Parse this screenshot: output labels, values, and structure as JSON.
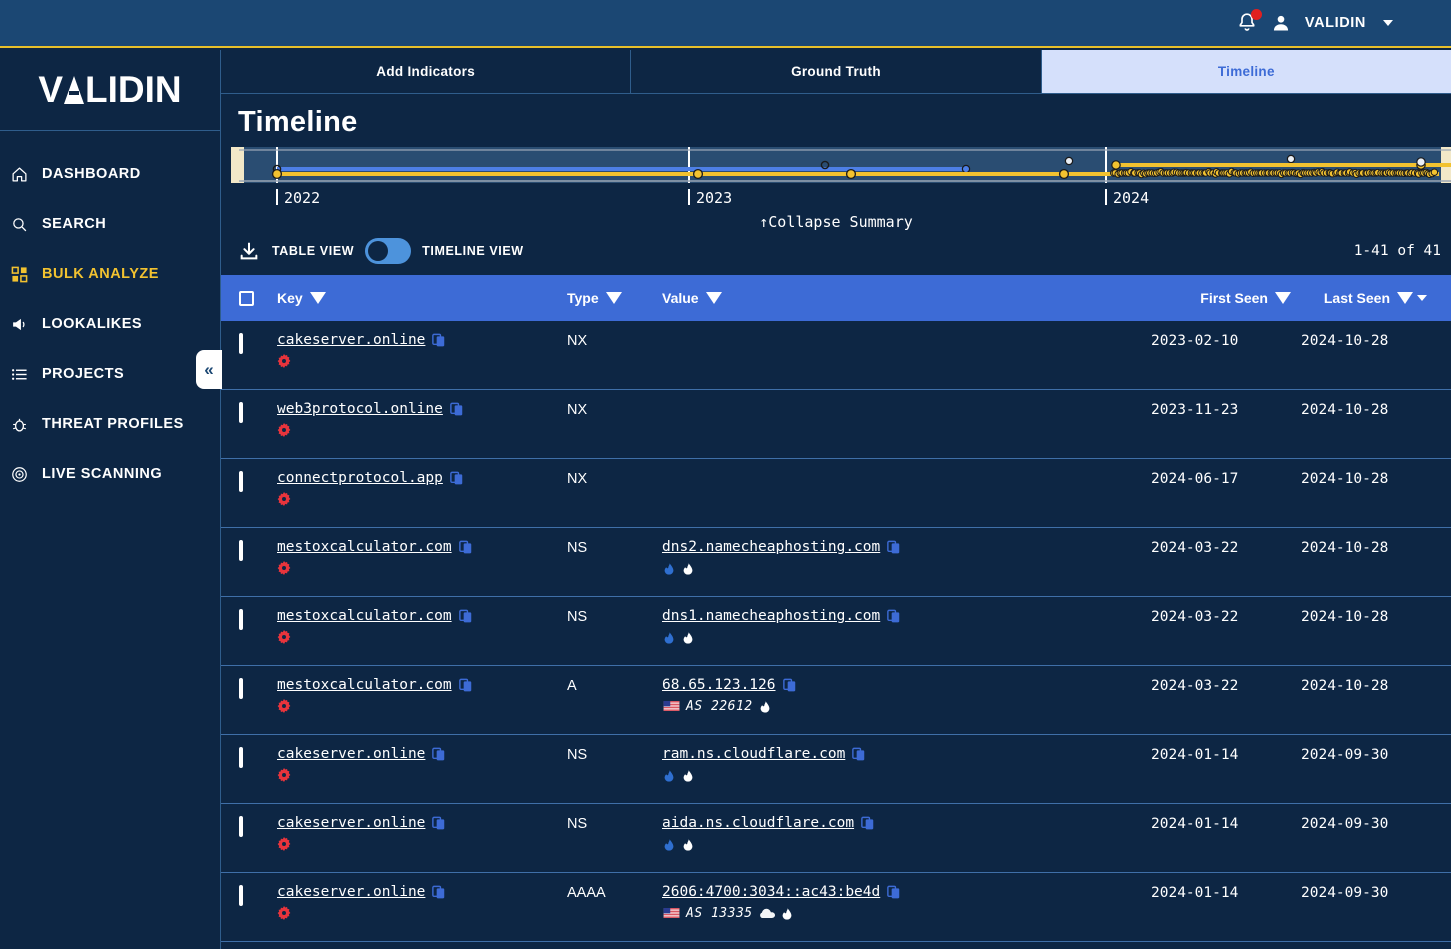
{
  "topbar": {
    "bell_icon": "bell-icon",
    "notification_badge": "",
    "user_icon": "user-avatar-icon",
    "user_name": "VALIDIN"
  },
  "sidebar": {
    "logo": "VALIDIN",
    "items": [
      {
        "label": "DASHBOARD",
        "icon": "home-icon",
        "active": false
      },
      {
        "label": "SEARCH",
        "icon": "search-icon",
        "active": false
      },
      {
        "label": "BULK ANALYZE",
        "icon": "grid-icon",
        "active": true
      },
      {
        "label": "LOOKALIKES",
        "icon": "megaphone-icon",
        "active": false
      },
      {
        "label": "PROJECTS",
        "icon": "list-icon",
        "active": false
      },
      {
        "label": "THREAT PROFILES",
        "icon": "bug-icon",
        "active": false
      },
      {
        "label": "LIVE SCANNING",
        "icon": "target-icon",
        "active": false
      }
    ],
    "collapse_label": "«"
  },
  "tabs": [
    {
      "label": "Add Indicators",
      "active": false
    },
    {
      "label": "Ground Truth",
      "active": false
    },
    {
      "label": "Timeline",
      "active": true
    }
  ],
  "main": {
    "title": "Timeline",
    "collapse_summary": "↑Collapse Summary",
    "download_icon": "download-icon",
    "table_view_label": "TABLE VIEW",
    "timeline_view_label": "TIMELINE VIEW",
    "toggle_state": "timeline",
    "count_label": "1-41 of 41"
  },
  "chart_data": {
    "type": "timeline",
    "title": "Timeline",
    "xlabels": [
      "2022",
      "2023",
      "2024"
    ],
    "xlabel_positions": [
      0.038,
      0.375,
      0.72
    ],
    "axis_range": [
      "2021-11",
      "2024-11"
    ],
    "grid": false,
    "series": [
      {
        "name": "blue-track",
        "color": "#4d7fe6",
        "start": 0.038,
        "end": 0.605
      },
      {
        "name": "yellow-track",
        "color": "#f2c230",
        "start": 0.038,
        "end": 0.99
      }
    ],
    "markers_color": "#f2c230",
    "selection_handle_color": "#f2e8c8"
  },
  "table": {
    "columns": [
      {
        "key": "checkbox",
        "label": "",
        "filter": false
      },
      {
        "key": "key",
        "label": "Key",
        "filter": true
      },
      {
        "key": "type",
        "label": "Type",
        "filter": true
      },
      {
        "key": "value",
        "label": "Value",
        "filter": true
      },
      {
        "key": "first_seen",
        "label": "First Seen",
        "filter": true
      },
      {
        "key": "last_seen",
        "label": "Last Seen",
        "filter": true,
        "sorted": "desc"
      }
    ],
    "rows": [
      {
        "key": "cakeserver.online",
        "key_gear": true,
        "type": "NX",
        "value": "",
        "value_icons": [],
        "first_seen": "2023-02-10",
        "last_seen": "2024-10-28"
      },
      {
        "key": "web3protocol.online",
        "key_gear": true,
        "type": "NX",
        "value": "",
        "value_icons": [],
        "first_seen": "2023-11-23",
        "last_seen": "2024-10-28"
      },
      {
        "key": "connectprotocol.app",
        "key_gear": true,
        "type": "NX",
        "value": "",
        "value_icons": [],
        "first_seen": "2024-06-17",
        "last_seen": "2024-10-28"
      },
      {
        "key": "mestoxcalculator.com",
        "key_gear": true,
        "type": "NS",
        "value": "dns2.namecheaphosting.com",
        "value_icons": [
          "flame-blue-icon",
          "flame-white-icon"
        ],
        "first_seen": "2024-03-22",
        "last_seen": "2024-10-28"
      },
      {
        "key": "mestoxcalculator.com",
        "key_gear": true,
        "type": "NS",
        "value": "dns1.namecheaphosting.com",
        "value_icons": [
          "flame-blue-icon",
          "flame-white-icon"
        ],
        "first_seen": "2024-03-22",
        "last_seen": "2024-10-28"
      },
      {
        "key": "mestoxcalculator.com",
        "key_gear": true,
        "type": "A",
        "value": "68.65.123.126",
        "flag": "us-flag-icon",
        "as_label": "AS 22612",
        "value_icons": [
          "flame-white-icon"
        ],
        "first_seen": "2024-03-22",
        "last_seen": "2024-10-28"
      },
      {
        "key": "cakeserver.online",
        "key_gear": true,
        "type": "NS",
        "value": "ram.ns.cloudflare.com",
        "value_icons": [
          "flame-blue-icon",
          "flame-white-icon"
        ],
        "first_seen": "2024-01-14",
        "last_seen": "2024-09-30"
      },
      {
        "key": "cakeserver.online",
        "key_gear": true,
        "type": "NS",
        "value": "aida.ns.cloudflare.com",
        "value_icons": [
          "flame-blue-icon",
          "flame-white-icon"
        ],
        "first_seen": "2024-01-14",
        "last_seen": "2024-09-30"
      },
      {
        "key": "cakeserver.online",
        "key_gear": true,
        "type": "AAAA",
        "value": "2606:4700:3034::ac43:be4d",
        "flag": "us-flag-icon",
        "as_label": "AS 13335",
        "value_icons": [
          "cloud-icon",
          "flame-white-icon"
        ],
        "first_seen": "2024-01-14",
        "last_seen": "2024-09-30"
      }
    ]
  },
  "colors": {
    "bg": "#0d2644",
    "topbar": "#1b4773",
    "accent_yellow": "#f2c230",
    "accent_blue": "#3d6bd6",
    "tab_active_bg": "#d5e0fb",
    "row_border": "#3f6fa8",
    "danger_red": "#e8343c"
  }
}
